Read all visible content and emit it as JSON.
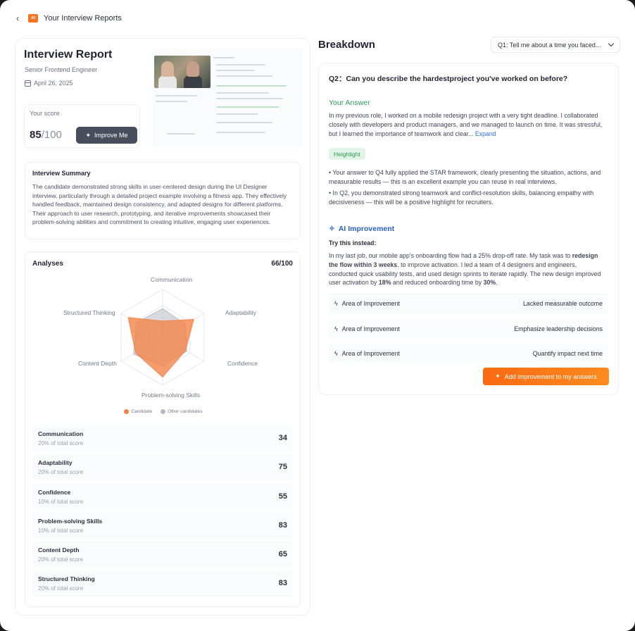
{
  "header": {
    "title": "Your Interview Reports",
    "logo_text": "AI"
  },
  "report": {
    "title": "Interview Report",
    "role": "Senior Frontend Engineer",
    "date": "April 26, 2025",
    "score_label": "Your score",
    "score_value": "85",
    "score_total": "/100",
    "improve_label": "Improve Me"
  },
  "summary": {
    "title": "Interview Summary",
    "text": "The candidate demonstrated strong skills in user-centered design during the UI Designer interview, particularly through a detailed project example involving a fitness app. They effectively handled feedback, maintained design consistency, and adapted designs for different platforms. Their approach to user research, prototyping, and iterative improvements showcased their problem-solving abilities and commitment to creating intuitive, engaging user experiences."
  },
  "analyses": {
    "title": "Analyses",
    "score": "66/100",
    "axes": [
      "Communication",
      "Adaptability",
      "Confidence",
      "Problem-solving Skills",
      "Content Depth",
      "Structured Thinking"
    ],
    "candidate_values": [
      34,
      75,
      55,
      83,
      65,
      83
    ],
    "other_values": [
      60,
      55,
      58,
      60,
      70,
      62
    ],
    "legend": {
      "candidate": "Candidate",
      "others": "Other candidates"
    },
    "colors": {
      "candidate": "#f5844a",
      "others": "#b8bcc5"
    },
    "metrics": [
      {
        "name": "Communication",
        "weight": "20% of total score",
        "value": "34"
      },
      {
        "name": "Adaptability",
        "weight": "20% of total score",
        "value": "75"
      },
      {
        "name": "Confidence",
        "weight": "10% of total score",
        "value": "55"
      },
      {
        "name": "Problem-solving Skills",
        "weight": "10% of total score",
        "value": "83"
      },
      {
        "name": "Content Depth",
        "weight": "20% of total score",
        "value": "65"
      },
      {
        "name": "Structured Thinking",
        "weight": "20% of total score",
        "value": "83"
      }
    ]
  },
  "breakdown": {
    "title": "Breakdown",
    "question_select": "Q1: Tell me about a time you faced...",
    "question": "Q2：Can you describe the hardestproject you've worked on before?",
    "your_answer_title": "Your Answer",
    "your_answer_text": "In my previous role, I worked on a mobile redesign project with a very tight deadline. I collaborated closely with developers and product managers, and we managed to launch on time. It was stressful, but I learned the importance of teamwork and clear...",
    "expand_label": "Expand",
    "highlight_label": "Heighlight",
    "highlights": [
      "• Your answer to Q4 fully applied the STAR framework, clearly presenting the situation, actions, and measurable results — this is an excellent example you can reuse in real interviews.",
      "• In Q2, you demonstrated strong teamwork and conflict-resolution skills, balancing empathy with decisiveness — this will be a positive highlight for recruiters."
    ],
    "ai_title": "AI Improvement",
    "try_label": "Try this instead:",
    "ai_text_1": "In my last job, our mobile app's onboarding flow had a 25% drop-off rate. My task was to ",
    "ai_text_bold_1": "redesign the flow within 3 weeks",
    "ai_text_2": ", to improve activation. I led a team of 4 designers and engineers, conducted quick usability tests, and used design sprints to iterate rapidly. The new design improved user activation by ",
    "ai_text_bold_2": "18%",
    "ai_text_3": " and reduced onboarding time by ",
    "ai_text_bold_3": "30%",
    "ai_text_4": ".",
    "areas": [
      {
        "label": "Area of Improvement",
        "value": "Lacked measurable outcome"
      },
      {
        "label": "Area of Improvement",
        "value": "Emphasize leadership decisions"
      },
      {
        "label": "Area of Improvement",
        "value": "Quantify impact next time"
      }
    ],
    "add_button": "Add improvement to my answers"
  }
}
